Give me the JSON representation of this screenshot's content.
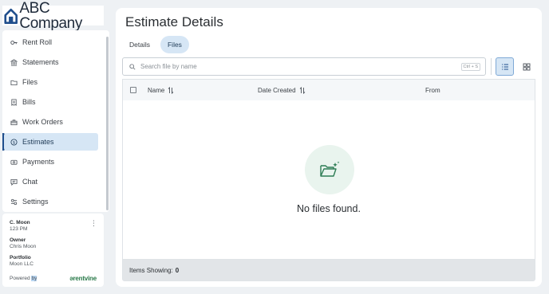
{
  "logo": {
    "text": "ABC Company"
  },
  "sidebar": {
    "items": [
      {
        "label": "Rent Roll",
        "icon": "key-icon"
      },
      {
        "label": "Statements",
        "icon": "bank-icon"
      },
      {
        "label": "Files",
        "icon": "folder-icon"
      },
      {
        "label": "Bills",
        "icon": "receipt-icon"
      },
      {
        "label": "Work Orders",
        "icon": "toolbox-icon"
      },
      {
        "label": "Estimates",
        "icon": "dollar-icon",
        "active": true
      },
      {
        "label": "Payments",
        "icon": "payment-icon"
      },
      {
        "label": "Chat",
        "icon": "chat-icon"
      },
      {
        "label": "Settings",
        "icon": "settings-icon"
      }
    ]
  },
  "profile": {
    "name": "C. Moon",
    "unit": "123 PM",
    "owner_label": "Owner",
    "owner_value": "Chris Moon",
    "portfolio_label": "Portfolio",
    "portfolio_value": "Moon LLC",
    "powered_prefix": "Powered ",
    "powered_highlight": "by",
    "brand": "ərentvine"
  },
  "main": {
    "title": "Estimate Details",
    "tabs": [
      {
        "label": "Details",
        "active": false
      },
      {
        "label": "Files",
        "active": true
      }
    ],
    "search": {
      "placeholder": "Search file by name",
      "shortcut": "Ctrl + S"
    },
    "table": {
      "columns": [
        "Name",
        "Date Created",
        "From"
      ],
      "empty_message": "No files found.",
      "footer_label": "Items Showing:",
      "footer_count": "0"
    }
  },
  "colors": {
    "accent": "#1f4e8c",
    "active_bg": "#d6e6f5",
    "brand_green": "#2a7a4a"
  }
}
